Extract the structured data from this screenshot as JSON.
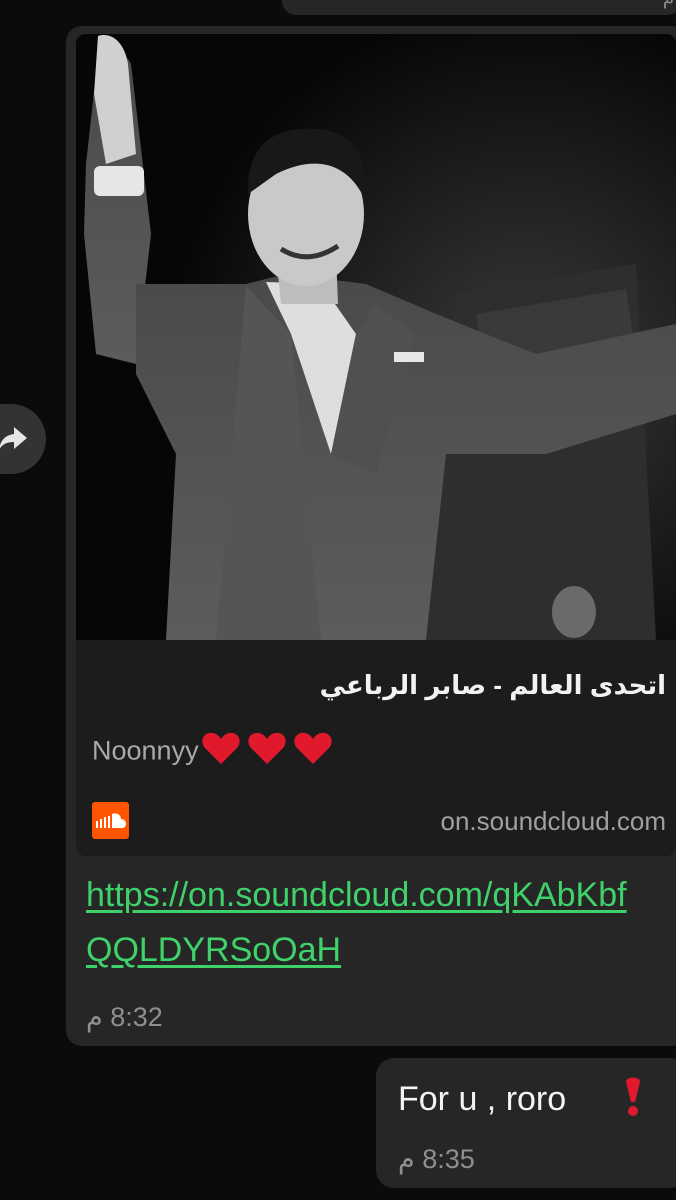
{
  "previous_message": {
    "time": "م"
  },
  "incoming_message": {
    "image_icon": "photo-of-singer",
    "preview": {
      "title": "اتحدى العالم - صابر الرباعي",
      "description": "Noonnyy",
      "hearts_icon": "red-heart-icon",
      "site_icon": "soundcloud-icon",
      "domain": "on.soundcloud.com"
    },
    "link_text": "https://on.soundcloud.com/qKAbKbfQQLDYRSoOaH",
    "time": "8:32 م"
  },
  "forward_button": {
    "icon": "forward-arrow-icon"
  },
  "outgoing_message": {
    "text": "For u , roro",
    "emoji_icon": "red-exclamation-icon",
    "time": "8:35 م"
  },
  "colors": {
    "background": "#0b0b0b",
    "bubble": "#262626",
    "link_green": "#3fd26a",
    "soundcloud_orange": "#ff5500",
    "heart_red": "#e0192c"
  }
}
